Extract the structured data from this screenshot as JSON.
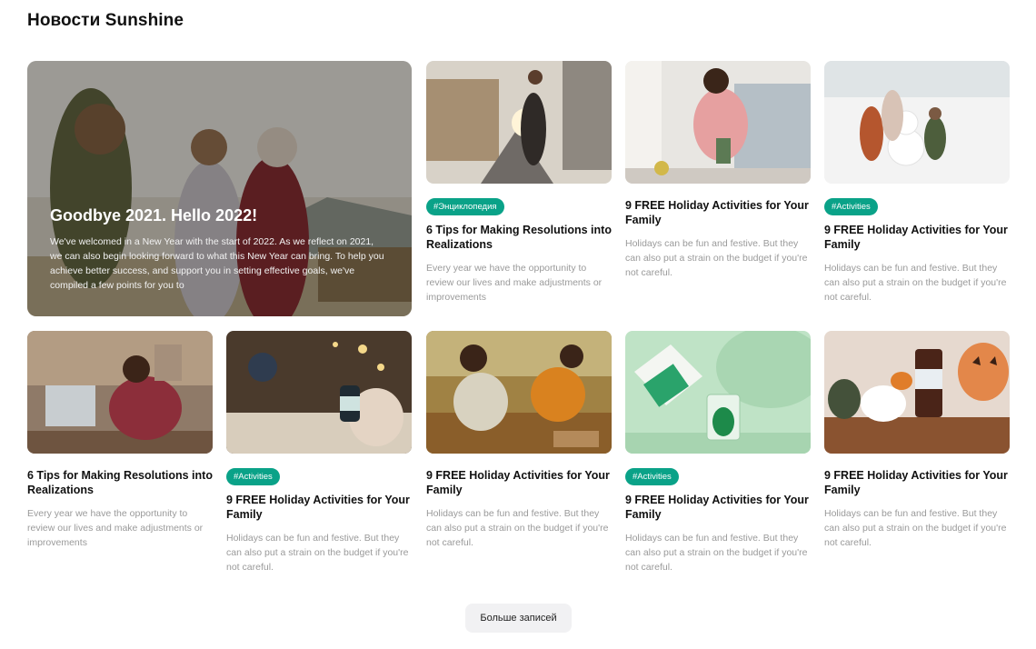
{
  "page": {
    "title": "Новости Sunshine"
  },
  "hero": {
    "title": "Goodbye 2021. Hello 2022!",
    "text": "We've welcomed in a New Year with the start of 2022. As we reflect on 2021, we can also begin looking forward to what this New Year can bring.   To help you achieve better success, and support you in setting effective goals, we've compiled a few points for you to"
  },
  "cards": [
    {
      "tag": "#Энциклопедия",
      "title": "6 Tips for Making Resolutions into Realizations",
      "desc": "Every year we have the opportunity to review our lives and make adjustments or improvements"
    },
    {
      "title": "9 FREE Holiday Activities for Your Family",
      "desc": "Holidays can be fun and festive. But they can also put a strain on the budget if you're not careful."
    },
    {
      "tag": "#Activities",
      "title": "9 FREE Holiday Activities for Your Family",
      "desc": "Holidays can be fun and festive. But they can also put a strain on the budget if you're not careful."
    },
    {
      "title": "6 Tips for Making Resolutions into Realizations",
      "desc": "Every year we have the opportunity to review our lives and make adjustments or improvements"
    },
    {
      "tag": "#Activities",
      "title": "9 FREE Holiday Activities for Your Family",
      "desc": "Holidays can be fun and festive. But they can also put a strain on the budget if you're not careful."
    },
    {
      "title": "9 FREE Holiday Activities for Your Family",
      "desc": "Holidays can be fun and festive. But they can also put a strain on the budget if you're not careful."
    },
    {
      "tag": "#Activities",
      "title": "9 FREE Holiday Activities for Your Family",
      "desc": "Holidays can be fun and festive. But they can also put a strain on the budget if you're not careful."
    },
    {
      "title": "9 FREE Holiday Activities for Your Family",
      "desc": "Holidays can be fun and festive. But they can also put a strain on the budget if you're not careful."
    }
  ],
  "load_more": {
    "label": "Больше записей"
  },
  "colors": {
    "tag_bg": "#0aa288",
    "button_bg": "#f1f1f3",
    "muted_text": "#9a9a9a"
  }
}
